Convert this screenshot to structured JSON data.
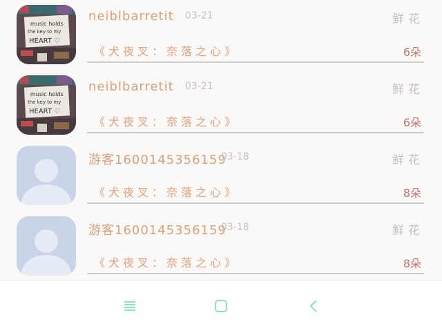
{
  "comments": [
    {
      "user": "neiblbarretit",
      "date": "03-21",
      "gift_label": "鲜花",
      "book": "《犬夜叉：奈落之心》",
      "count": "6朵",
      "avatar": "photo-avatar"
    },
    {
      "user": "neiblbarretit",
      "date": "03-21",
      "gift_label": "鲜花",
      "book": "《犬夜叉：奈落之心》",
      "count": "6朵",
      "avatar": "photo-avatar"
    },
    {
      "user": "游客1600145356159",
      "date": "03-18",
      "gift_label": "鲜花",
      "book": "《犬夜叉：奈落之心》",
      "count": "8朵",
      "avatar": "default-avatar"
    },
    {
      "user": "游客1600145356159",
      "date": "03-18",
      "gift_label": "鲜花",
      "book": "《犬夜叉：奈落之心》",
      "count": "8朵",
      "avatar": "default-avatar"
    }
  ],
  "avatar_photo_text": [
    "music holds",
    "the key to my",
    "HEART ♡"
  ],
  "navbar": {
    "menu_icon": "menu-icon",
    "home_icon": "home-icon",
    "back_icon": "back-icon"
  },
  "colors": {
    "username": "#d8a27c",
    "book_title": "#e3a27f",
    "count": "#c5736f",
    "nav_accent": "#8fe0bf",
    "default_avatar": "#c9d4e8"
  }
}
